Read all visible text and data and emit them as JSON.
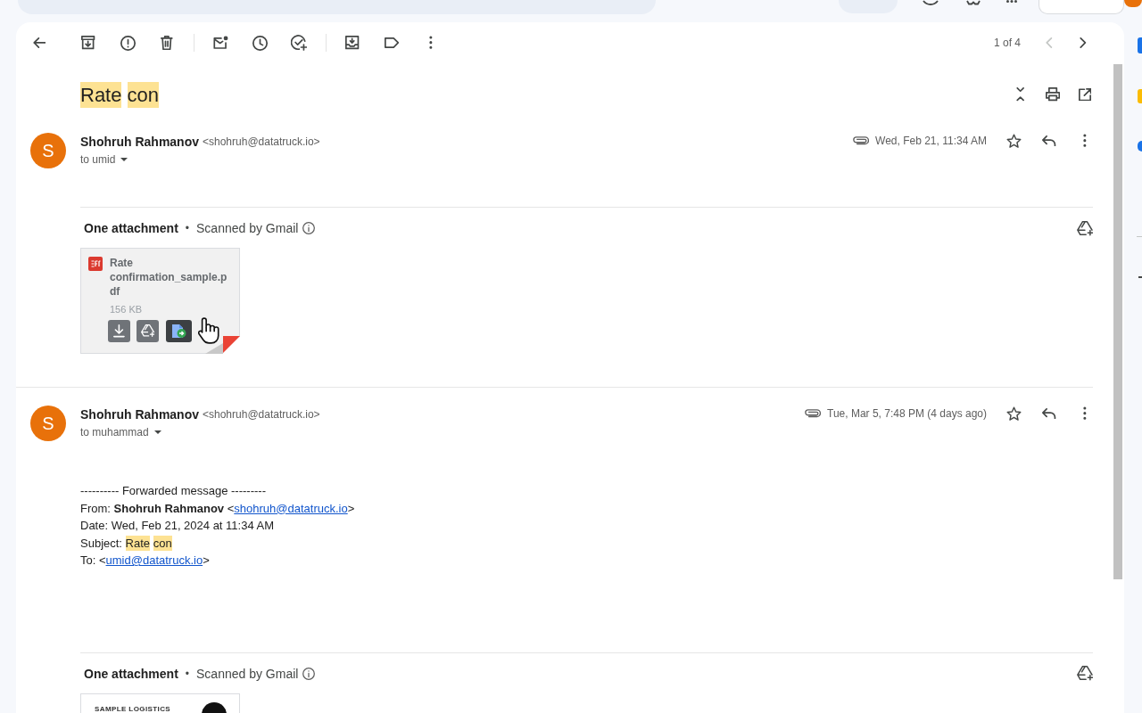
{
  "toolbar": {
    "pager": {
      "text": "1 of 4",
      "previous_disabled": true,
      "next_disabled": false
    }
  },
  "subject": {
    "words": [
      {
        "text": "Rate",
        "highlighted": true
      },
      {
        "text": "con",
        "highlighted": true
      }
    ]
  },
  "messages": [
    {
      "avatar_letter": "S",
      "sender_name": "Shohruh Rahmanov",
      "sender_email": "<shohruh@datatruck.io>",
      "recipient": "to umid",
      "has_attachment": true,
      "date": "Wed, Feb 21, 11:34 AM",
      "starred": false,
      "attachments": {
        "title": "One attachment",
        "separator": "•",
        "scan_note": "Scanned by Gmail",
        "files": [
          {
            "kind": "file",
            "name": "Rate confirmation_sample.pdf",
            "size": "156 KB",
            "hovered": true
          }
        ]
      }
    },
    {
      "avatar_letter": "S",
      "sender_name": "Shohruh Rahmanov",
      "sender_email": "<shohruh@datatruck.io>",
      "recipient": "to muhammad",
      "has_attachment": true,
      "date": "Tue, Mar 5, 7:48 PM (4 days ago)",
      "starred": false,
      "body": [
        {
          "kind": "text",
          "text": "---------- Forwarded message ---------"
        },
        {
          "kind": "sender",
          "label": "From:",
          "name": "Shohruh Rahmanov",
          "open": "<",
          "email": "shohruh@datatruck.io",
          "close": ">"
        },
        {
          "kind": "field",
          "label": "Date:",
          "value": "Wed, Feb 21, 2024 at 11:34 AM"
        },
        {
          "kind": "subject",
          "label": "Subject:",
          "words": [
            {
              "text": "Rate",
              "highlighted": true
            },
            {
              "text": "con",
              "highlighted": true
            }
          ]
        },
        {
          "kind": "recipient",
          "label": "To:",
          "open": "<",
          "email": "umid@datatruck.io",
          "close": ">"
        }
      ],
      "attachments": {
        "title": "One attachment",
        "separator": "•",
        "scan_note": "Scanned by Gmail",
        "files": [
          {
            "kind": "preview",
            "preview_text": "SAMPLE LOGISTICS"
          }
        ]
      }
    }
  ]
}
